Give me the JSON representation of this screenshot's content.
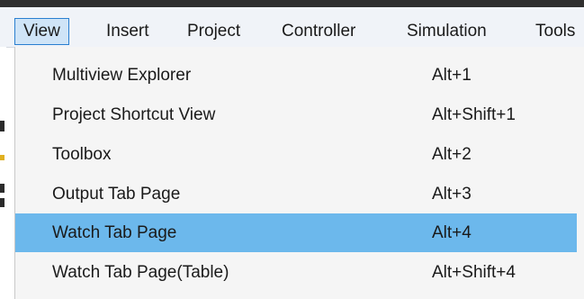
{
  "menubar": {
    "items": [
      {
        "label": "View",
        "active": true
      },
      {
        "label": "Insert",
        "active": false
      },
      {
        "label": "Project",
        "active": false
      },
      {
        "label": "Controller",
        "active": false
      },
      {
        "label": "Simulation",
        "active": false
      },
      {
        "label": "Tools",
        "active": false
      }
    ]
  },
  "view_menu": {
    "items": [
      {
        "label": "Multiview Explorer",
        "shortcut": "Alt+1"
      },
      {
        "label": "Project Shortcut View",
        "shortcut": "Alt+Shift+1"
      },
      {
        "label": "Toolbox",
        "shortcut": "Alt+2"
      },
      {
        "label": "Output Tab Page",
        "shortcut": "Alt+3"
      },
      {
        "label": "Watch Tab Page",
        "shortcut": "Alt+4",
        "highlighted": true
      },
      {
        "label": "Watch Tab Page(Table)",
        "shortcut": "Alt+Shift+4"
      }
    ]
  },
  "colors": {
    "highlight": "#6cb8ec",
    "active_menu_bg": "#cfe4f7",
    "active_menu_border": "#2a7fd0",
    "menu_bg": "#f5f5f5"
  }
}
